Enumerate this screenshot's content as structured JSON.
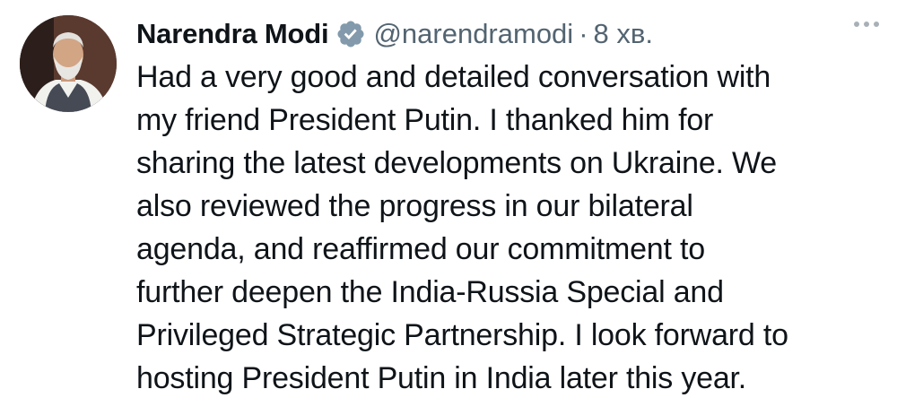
{
  "author": {
    "display_name": "Narendra Modi",
    "handle": "@narendramodi",
    "separator": "·",
    "time": "8 хв.",
    "verified_icon": "verified-badge-icon"
  },
  "more_icon": "more-horizontal-icon",
  "tweet": {
    "lines": [
      "Had a very good and detailed conversation with",
      "my friend President Putin. I thanked him for",
      "sharing the latest developments on Ukraine. We",
      "also reviewed the progress in our bilateral",
      "agenda, and reaffirmed our commitment to",
      "further deepen the India-Russia Special and",
      "Privileged Strategic Partnership. I look forward to",
      "hosting President Putin in India later this year."
    ]
  },
  "colors": {
    "text": "#0f1419",
    "secondary": "#536471",
    "verified": "#829aab"
  }
}
